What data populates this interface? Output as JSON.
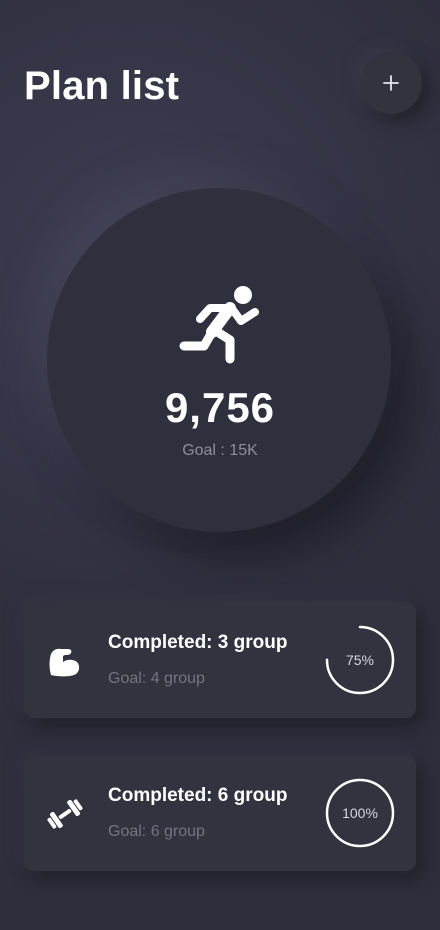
{
  "header": {
    "title": "Plan list",
    "add_icon": "plus-icon"
  },
  "hero": {
    "icon": "running-person-icon",
    "steps": "9,756",
    "goal_label": "Goal : 15K"
  },
  "plans": [
    {
      "icon": "flexed-arm-icon",
      "title": "Completed: 3 group",
      "goal": "Goal: 4 group",
      "progress_label": "75%",
      "progress": 0.75
    },
    {
      "icon": "dumbbell-icon",
      "title": "Completed: 6 group",
      "goal": "Goal: 6 group",
      "progress_label": "100%",
      "progress": 1.0
    }
  ],
  "colors": {
    "background": "#2f2e3d",
    "text_primary": "#ffffff",
    "text_secondary": "#8f8e9c",
    "ring_stroke": "#ffffff"
  }
}
